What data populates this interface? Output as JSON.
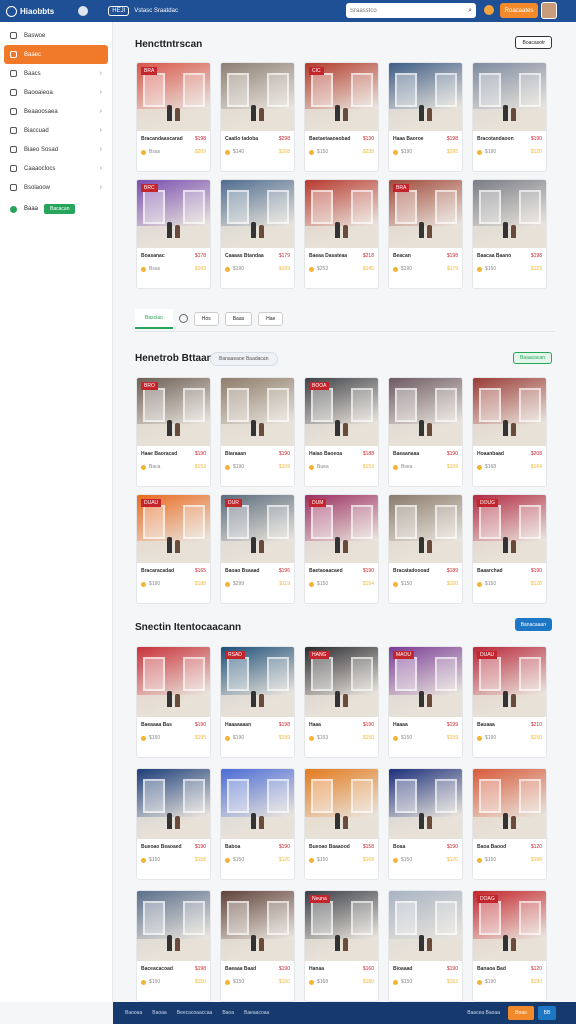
{
  "topbar": {
    "logo_text": "Hiaobbts",
    "pill_label": "HEJI",
    "link_label": "Vstasc Sraatdac",
    "search_placeholder": "Sraasstco",
    "cta_label": "Roacaates"
  },
  "sidebar": {
    "items": [
      {
        "label": "Baswoe",
        "icon": "home-icon",
        "active": false
      },
      {
        "label": "Baaec",
        "icon": "store-icon",
        "active": true
      },
      {
        "label": "Baacs",
        "icon": "tag-icon",
        "active": false
      },
      {
        "label": "Baooaieoa",
        "icon": "list-icon",
        "active": false
      },
      {
        "label": "Beaaoosaea",
        "icon": "clock-icon",
        "active": false
      },
      {
        "label": "Biaccuad",
        "icon": "box-icon",
        "active": false
      },
      {
        "label": "Biaeo Sosad",
        "icon": "building-icon",
        "active": false
      },
      {
        "label": "Caaaoclocs",
        "icon": "calendar-icon",
        "active": false
      },
      {
        "label": "Bsolaoow",
        "icon": "folder-icon",
        "active": false
      }
    ],
    "green_label": "Baaa",
    "green_button": "Bacacan"
  },
  "section1": {
    "title": "Hencttntrscan",
    "button": "Boacasotr",
    "cards": [
      {
        "title": "Bracandaascarad",
        "price": "$198",
        "meta": "Bsas",
        "price2": "$209",
        "tag": "BRA",
        "bg": "#d9554a"
      },
      {
        "title": "Caatlo tadoba",
        "price": "$298",
        "meta": "$140",
        "price2": "$168",
        "tag": "",
        "bg": "#8c7f74"
      },
      {
        "title": "Baetaetaaoaobad",
        "price": "$130",
        "meta": "$150",
        "price2": "$238",
        "tag": "CIC",
        "bg": "#b23b2c"
      },
      {
        "title": "Haaa Baoroe",
        "price": "$198",
        "meta": "$190",
        "price2": "$295",
        "tag": "",
        "bg": "#3e5d86"
      },
      {
        "title": "Bracotandaoon",
        "price": "$190",
        "meta": "$190",
        "price2": "$120",
        "tag": "",
        "bg": "#7d8aa0"
      },
      {
        "title": "Boasanac",
        "price": "$178",
        "meta": "Bsas",
        "price2": "$169",
        "tag": "BRC",
        "bg": "#7a4db0"
      },
      {
        "title": "Caaaas Btandaa",
        "price": "$179",
        "meta": "$190",
        "price2": "$159",
        "tag": "",
        "bg": "#4f6d90"
      },
      {
        "title": "Baeaa Dasateaa",
        "price": "$218",
        "meta": "$253",
        "price2": "$145",
        "tag": "",
        "bg": "#b8392e"
      },
      {
        "title": "Beacan",
        "price": "$198",
        "meta": "$190",
        "price2": "$179",
        "tag": "BRA",
        "bg": "#a04a3a"
      },
      {
        "title": "Baacaa Baano",
        "price": "$198",
        "meta": "$150",
        "price2": "$129",
        "tag": "",
        "bg": "#7a7d86"
      }
    ]
  },
  "tabs": [
    "Basciao",
    "Hos",
    "Baas",
    "Hae"
  ],
  "section2": {
    "title": "Henetrob Bttaan",
    "badge": "Banaaeaoe Baadacan",
    "button": "Baaacacan",
    "cards": [
      {
        "title": "Haae Baoracad",
        "price": "$190",
        "meta": "Baca",
        "price2": "$153",
        "tag": "BRO",
        "bg": "#6b5e55"
      },
      {
        "title": "Biaraaan",
        "price": "$190",
        "meta": "$190",
        "price2": "$159",
        "tag": "",
        "bg": "#8d7c6a"
      },
      {
        "title": "Haiao Baoeoa",
        "price": "$188",
        "meta": "Buea",
        "price2": "$153",
        "tag": "BOOA",
        "bg": "#3f4147"
      },
      {
        "title": "Baeaanaaa",
        "price": "$190",
        "meta": "Bsea",
        "price2": "$159",
        "tag": "",
        "bg": "#6d5a63"
      },
      {
        "title": "Hoaanbaad",
        "price": "$208",
        "meta": "$168",
        "price2": "$164",
        "tag": "",
        "bg": "#9a3b35"
      },
      {
        "title": "Bracaracadad",
        "price": "$165",
        "meta": "$190",
        "price2": "$188",
        "tag": "DUAU",
        "bg": "#ea6a1f"
      },
      {
        "title": "Baoao Bsaaad",
        "price": "$196",
        "meta": "$299",
        "price2": "$119",
        "tag": "DUR",
        "bg": "#5a6b7c"
      },
      {
        "title": "Baetaoaacaed",
        "price": "$190",
        "meta": "$150",
        "price2": "$154",
        "tag": "DUM",
        "bg": "#9c2f62"
      },
      {
        "title": "Bracatadoooad",
        "price": "$189",
        "meta": "$150",
        "price2": "$150",
        "tag": "",
        "bg": "#8a7b6c"
      },
      {
        "title": "Baaarchad",
        "price": "$190",
        "meta": "$150",
        "price2": "$128",
        "tag": "DOUG",
        "bg": "#b12a42"
      }
    ]
  },
  "section3": {
    "title": "Snectin Itentocaacann",
    "button": "Banacaaan",
    "cards": [
      {
        "title": "Baeaaaa Bas",
        "price": "$190",
        "meta": "$150",
        "price2": "$195",
        "tag": "",
        "bg": "#c8323a"
      },
      {
        "title": "Haaaaaaan",
        "price": "$198",
        "meta": "$190",
        "price2": "$199",
        "tag": "RSAD",
        "bg": "#1d4f79"
      },
      {
        "title": "Haaa",
        "price": "$190",
        "meta": "$153",
        "price2": "$150",
        "tag": "HANG",
        "bg": "#2a2a2f"
      },
      {
        "title": "Haaaa",
        "price": "$199",
        "meta": "$150",
        "price2": "$159",
        "tag": "MAOU",
        "bg": "#7a3d96"
      },
      {
        "title": "Bauaaa",
        "price": "$210",
        "meta": "$190",
        "price2": "$150",
        "tag": "DUAU",
        "bg": "#b8283a"
      },
      {
        "title": "Bueoao Beaoaed",
        "price": "$190",
        "meta": "$150",
        "price2": "$158",
        "tag": "",
        "bg": "#1c3e7a"
      },
      {
        "title": "Baboa",
        "price": "$190",
        "meta": "$150",
        "price2": "$120",
        "tag": "",
        "bg": "#4a6bd6"
      },
      {
        "title": "Bueoao Baaaood",
        "price": "$158",
        "meta": "$150",
        "price2": "$168",
        "tag": "",
        "bg": "#e47a1d"
      },
      {
        "title": "Boaa",
        "price": "$190",
        "meta": "$150",
        "price2": "$120",
        "tag": "",
        "bg": "#1b2f7a"
      },
      {
        "title": "Baoa Baood",
        "price": "$120",
        "meta": "$150",
        "price2": "$198",
        "tag": "",
        "bg": "#d85a3a"
      },
      {
        "title": "Baceacacoad",
        "price": "$198",
        "meta": "$150",
        "price2": "$150",
        "tag": "",
        "bg": "#5a6f8c"
      },
      {
        "title": "Baeaaa Baad",
        "price": "$190",
        "meta": "$150",
        "price2": "$150",
        "tag": "",
        "bg": "#60423a"
      },
      {
        "title": "Hanaa",
        "price": "$160",
        "meta": "$168",
        "price2": "$180",
        "tag": "Neuna",
        "bg": "#383c44"
      },
      {
        "title": "Bioaaad",
        "price": "$190",
        "meta": "$150",
        "price2": "$153",
        "tag": "",
        "bg": "#a8b4c4"
      },
      {
        "title": "Banaoa Bad",
        "price": "$120",
        "meta": "$190",
        "price2": "$190",
        "tag": "DOAG",
        "bg": "#c4242b"
      }
    ]
  },
  "footer": {
    "links": [
      "Baooaa",
      "Baoaa",
      "Beecacoaaccaa",
      "Baoa",
      "Baeaacoaa"
    ],
    "label": "Baacea Baoaa",
    "orange_button": "Boao",
    "blue_button": "BB"
  }
}
